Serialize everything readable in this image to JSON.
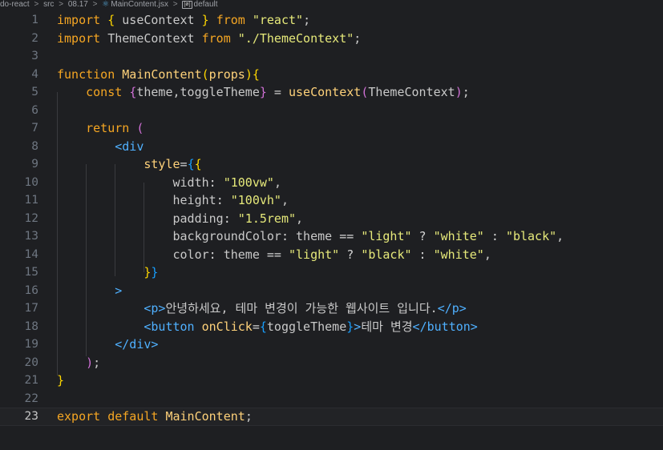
{
  "breadcrumb": {
    "items": [
      "do-react",
      "src",
      "08.17",
      "MainContent.jsx",
      "default"
    ],
    "separator": ">",
    "file_icon": "react-icon",
    "symbol_icon": "symbol-variable-icon"
  },
  "editor": {
    "current_line": "23",
    "line_numbers": [
      "1",
      "2",
      "3",
      "4",
      "5",
      "6",
      "7",
      "8",
      "9",
      "10",
      "11",
      "12",
      "13",
      "14",
      "15",
      "16",
      "17",
      "18",
      "19",
      "20",
      "21",
      "22",
      "23"
    ],
    "lines": [
      [
        [
          "kw",
          "import"
        ],
        [
          "pl",
          " "
        ],
        [
          "br1",
          "{"
        ],
        [
          "pl",
          " useContext "
        ],
        [
          "br1",
          "}"
        ],
        [
          "pl",
          " "
        ],
        [
          "kw",
          "from"
        ],
        [
          "pl",
          " "
        ],
        [
          "str",
          "\"react\""
        ],
        [
          "pl",
          ";"
        ]
      ],
      [
        [
          "kw",
          "import"
        ],
        [
          "pl",
          " ThemeContext "
        ],
        [
          "kw",
          "from"
        ],
        [
          "pl",
          " "
        ],
        [
          "str",
          "\"./ThemeContext\""
        ],
        [
          "pl",
          ";"
        ]
      ],
      [],
      [
        [
          "kw",
          "function"
        ],
        [
          "pl",
          " "
        ],
        [
          "fn",
          "MainContent"
        ],
        [
          "br1",
          "("
        ],
        [
          "attr",
          "props"
        ],
        [
          "br1",
          ")"
        ],
        [
          "br1",
          "{"
        ]
      ],
      [
        [
          "pl",
          "    "
        ],
        [
          "kw",
          "const"
        ],
        [
          "pl",
          " "
        ],
        [
          "br2",
          "{"
        ],
        [
          "prop",
          "theme,toggleTheme"
        ],
        [
          "br2",
          "}"
        ],
        [
          "pl",
          " = "
        ],
        [
          "fn",
          "useContext"
        ],
        [
          "br2",
          "("
        ],
        [
          "prop",
          "ThemeContext"
        ],
        [
          "br2",
          ")"
        ],
        [
          "pl",
          ";"
        ]
      ],
      [],
      [
        [
          "pl",
          "    "
        ],
        [
          "kw",
          "return"
        ],
        [
          "pl",
          " "
        ],
        [
          "br2",
          "("
        ]
      ],
      [
        [
          "pl",
          "        "
        ],
        [
          "tag",
          "<div"
        ]
      ],
      [
        [
          "pl",
          "            "
        ],
        [
          "attr",
          "style"
        ],
        [
          "op",
          "="
        ],
        [
          "br3",
          "{"
        ],
        [
          "br1",
          "{"
        ]
      ],
      [
        [
          "pl",
          "                "
        ],
        [
          "prop",
          "width"
        ],
        [
          "op",
          ": "
        ],
        [
          "str",
          "\"100vw\""
        ],
        [
          "pl",
          ","
        ]
      ],
      [
        [
          "pl",
          "                "
        ],
        [
          "prop",
          "height"
        ],
        [
          "op",
          ": "
        ],
        [
          "str",
          "\"100vh\""
        ],
        [
          "pl",
          ","
        ]
      ],
      [
        [
          "pl",
          "                "
        ],
        [
          "prop",
          "padding"
        ],
        [
          "op",
          ": "
        ],
        [
          "str",
          "\"1.5rem\""
        ],
        [
          "pl",
          ","
        ]
      ],
      [
        [
          "pl",
          "                "
        ],
        [
          "prop",
          "backgroundColor"
        ],
        [
          "op",
          ": "
        ],
        [
          "prop",
          "theme"
        ],
        [
          "op",
          " == "
        ],
        [
          "str",
          "\"light\""
        ],
        [
          "op",
          " ? "
        ],
        [
          "str",
          "\"white\""
        ],
        [
          "op",
          " : "
        ],
        [
          "str",
          "\"black\""
        ],
        [
          "pl",
          ","
        ]
      ],
      [
        [
          "pl",
          "                "
        ],
        [
          "prop",
          "color"
        ],
        [
          "op",
          ": "
        ],
        [
          "prop",
          "theme"
        ],
        [
          "op",
          " == "
        ],
        [
          "str",
          "\"light\""
        ],
        [
          "op",
          " ? "
        ],
        [
          "str",
          "\"black\""
        ],
        [
          "op",
          " : "
        ],
        [
          "str",
          "\"white\""
        ],
        [
          "pl",
          ","
        ]
      ],
      [
        [
          "pl",
          "            "
        ],
        [
          "br1",
          "}"
        ],
        [
          "br3",
          "}"
        ]
      ],
      [
        [
          "pl",
          "        "
        ],
        [
          "tag",
          ">"
        ]
      ],
      [
        [
          "pl",
          "            "
        ],
        [
          "tag",
          "<p>"
        ],
        [
          "pl",
          "안녕하세요, 테마 변경이 가능한 웹사이트 입니다."
        ],
        [
          "tag",
          "</p>"
        ]
      ],
      [
        [
          "pl",
          "            "
        ],
        [
          "tag",
          "<button"
        ],
        [
          "pl",
          " "
        ],
        [
          "attr",
          "onClick"
        ],
        [
          "op",
          "="
        ],
        [
          "br3",
          "{"
        ],
        [
          "prop",
          "toggleTheme"
        ],
        [
          "br3",
          "}"
        ],
        [
          "tag",
          ">"
        ],
        [
          "pl",
          "테마 변경"
        ],
        [
          "tag",
          "</button>"
        ]
      ],
      [
        [
          "pl",
          "        "
        ],
        [
          "tag",
          "</div>"
        ]
      ],
      [
        [
          "pl",
          "    "
        ],
        [
          "br2",
          ")"
        ],
        [
          "pl",
          ";"
        ]
      ],
      [
        [
          "br1",
          "}"
        ]
      ],
      [],
      [
        [
          "kw",
          "export"
        ],
        [
          "pl",
          " "
        ],
        [
          "kw",
          "default"
        ],
        [
          "pl",
          " "
        ],
        [
          "fn",
          "MainContent"
        ],
        [
          "pl",
          ";"
        ]
      ]
    ]
  },
  "colors": {
    "background": "#1e1f22",
    "line_number": "#6e7681",
    "keyword": "#f5a623",
    "string": "#e6e97a",
    "tag": "#4fb0ff",
    "function": "#ffd27a"
  }
}
